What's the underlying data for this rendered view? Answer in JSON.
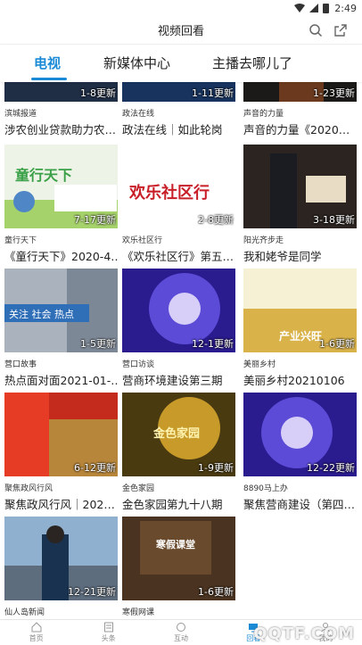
{
  "status": {
    "time": "2:49"
  },
  "header": {
    "title": "视频回看"
  },
  "tabs": [
    {
      "label": "电视",
      "active": true
    },
    {
      "label": "新媒体中心",
      "active": false
    },
    {
      "label": "主播去哪儿了",
      "active": false
    }
  ],
  "videos": [
    {
      "badge": "1-8更新",
      "category": "滨城报道",
      "title": "涉农创业贷款助力农…"
    },
    {
      "badge": "1-11更新",
      "category": "政法在线",
      "title": "政法在线｜如此轮岗"
    },
    {
      "badge": "1-23更新",
      "category": "声音的力量",
      "title": "声音的力量《2020…"
    },
    {
      "badge": "7-17更新",
      "category": "童行天下",
      "title": "《童行天下》2020-4…",
      "thumb_text": "童行天下"
    },
    {
      "badge": "2-8更新",
      "category": "欢乐社区行",
      "title": "《欢乐社区行》第五…",
      "thumb_text": "欢乐社区行"
    },
    {
      "badge": "3-18更新",
      "category": "阳光齐步走",
      "title": "我和姥爷是同学"
    },
    {
      "badge": "1-5更新",
      "category": "营口故事",
      "title": "热点面对面2021-01-…",
      "thumb_text": "关注 社会 热点"
    },
    {
      "badge": "12-1更新",
      "category": "营口访谈",
      "title": "营商环境建设第三期"
    },
    {
      "badge": "1-6更新",
      "category": "美丽乡村",
      "title": "美丽乡村20210106",
      "thumb_text": "产业兴旺"
    },
    {
      "badge": "6-12更新",
      "category": "聚焦政风行风",
      "title": "聚焦政风行风｜202…"
    },
    {
      "badge": "1-9更新",
      "category": "金色家园",
      "title": "金色家园第九十八期",
      "thumb_text": "金色家园"
    },
    {
      "badge": "12-22更新",
      "category": "8890马上办",
      "title": "聚焦营商建设（第四…"
    },
    {
      "badge": "12-21更新",
      "category": "仙人岛新闻",
      "title": ""
    },
    {
      "badge": "1-6更新",
      "category": "寒假网课",
      "title": "",
      "thumb_text": "寒假课堂"
    }
  ],
  "bottom_nav": [
    {
      "label": "首页",
      "icon": "home-icon"
    },
    {
      "label": "头条",
      "icon": "news-icon"
    },
    {
      "label": "互动",
      "icon": "interact-icon"
    },
    {
      "label": "回看",
      "icon": "tv-icon",
      "active": true
    },
    {
      "label": "我的",
      "icon": "user-icon"
    }
  ],
  "watermark": "QQTF.COM",
  "colors": {
    "accent": "#1a8ad6"
  }
}
